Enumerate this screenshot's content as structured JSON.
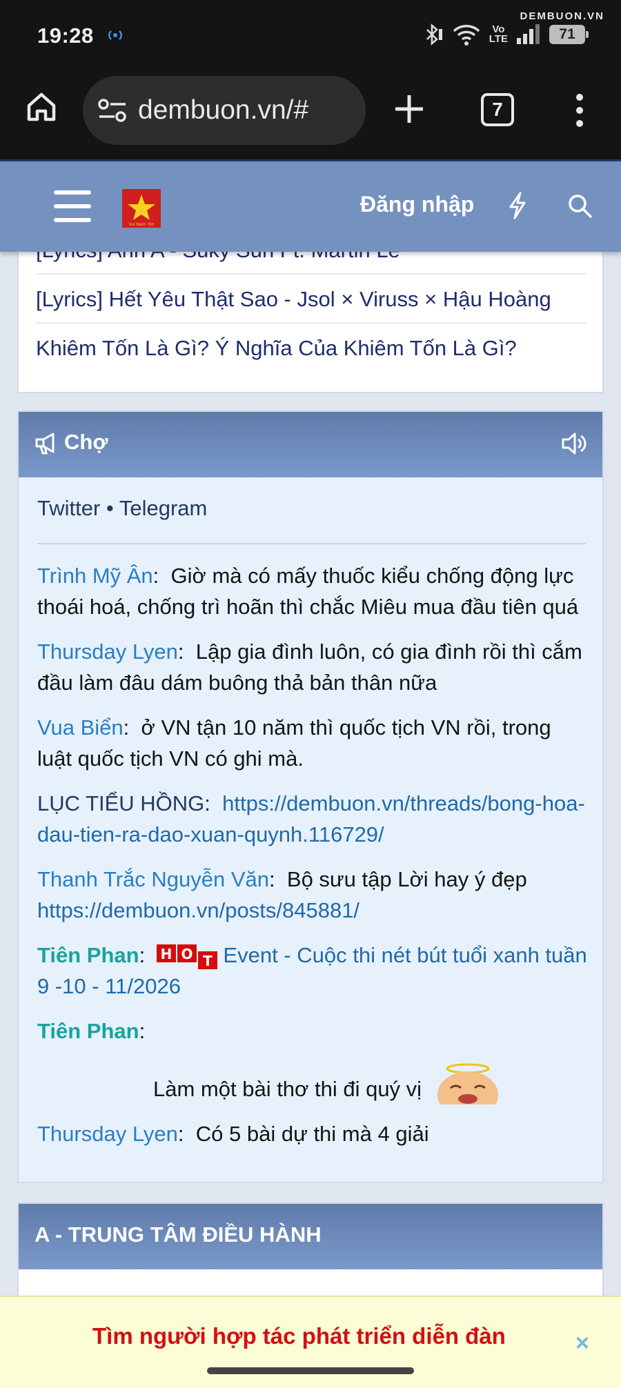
{
  "status_bar": {
    "time": "19:28",
    "watermark": "DEMBUON.VN",
    "network_label": "Vo\nLTE",
    "battery": "71",
    "icons": [
      "hotspot-icon",
      "bluetooth-icon",
      "wifi-icon",
      "signal-icon",
      "battery-icon"
    ]
  },
  "browser": {
    "url": "dembuon.vn/#",
    "tab_count": "7",
    "icons": [
      "home-icon",
      "site-settings-icon",
      "new-tab-icon",
      "more-menu-icon"
    ]
  },
  "forum_header": {
    "login_label": "Đăng nhập",
    "logo_text": "Vui Nam rộn",
    "icons": [
      "hamburger-icon",
      "bolt-icon",
      "search-icon"
    ],
    "colors": {
      "header_bg": "#7591c0",
      "logo_bg": "#d01d1d"
    }
  },
  "latest_links": {
    "items": [
      "[Lyrics] Anh A - Suky Sun Ft. Martin Lê",
      "[Lyrics] Hết Yêu Thật Sao - Jsol × Viruss × Hậu Hoàng",
      "Khiêm Tốn Là Gì? Ý Nghĩa Của Khiêm Tốn Là Gì?"
    ]
  },
  "chat_box": {
    "title": "Chợ",
    "social": {
      "twitter": "Twitter",
      "separator": " • ",
      "telegram": "Telegram"
    },
    "messages": [
      {
        "author": "Trình Mỹ Ân",
        "text": "Giờ mà có mấy thuốc kiểu chống động lực thoái hoá, chống trì hoãn thì chắc Miêu mua đầu tiên quá"
      },
      {
        "author": "Thursday Lyen",
        "text": "Lập gia đình luôn, có gia đình rồi thì cắm đầu làm đâu dám buông thả bản thân nữa"
      },
      {
        "author": "Vua Biển",
        "text": "ở VN tận 10 năm thì quốc tịch VN rồi, trong luật quốc tịch VN có ghi mà."
      },
      {
        "author": "LỤC TIỂU HỒNG",
        "link": "https://dembuon.vn/threads/bong-hoa-dau-tien-ra-dao-xuan-quynh.116729/"
      },
      {
        "author": "Thanh Trắc Nguyễn Văn",
        "text": "Bộ sưu tập Lời hay ý đẹp",
        "link": "https://dembuon.vn/posts/845881/"
      },
      {
        "author": "Tiên Phan",
        "badge": "HOT",
        "link": "Event - Cuộc thi nét bút tuổi xanh tuần 9 -10 - 11/2026"
      },
      {
        "author": "Tiên Phan",
        "poem": "Làm một bài thơ thi đi quý vị"
      },
      {
        "author": "Thursday Lyen",
        "text": "Có 5 bài dự thi mà 4 giải"
      }
    ],
    "colors": {
      "author": "#2a7ec2",
      "staff": "#1aa39e",
      "link": "#2169a9"
    }
  },
  "section": {
    "title": "A - TRUNG TÂM ĐIỀU HÀNH"
  },
  "notice": {
    "text": "Tìm người hợp tác phát triển diễn đàn",
    "close": "×",
    "color": "#d21010"
  }
}
